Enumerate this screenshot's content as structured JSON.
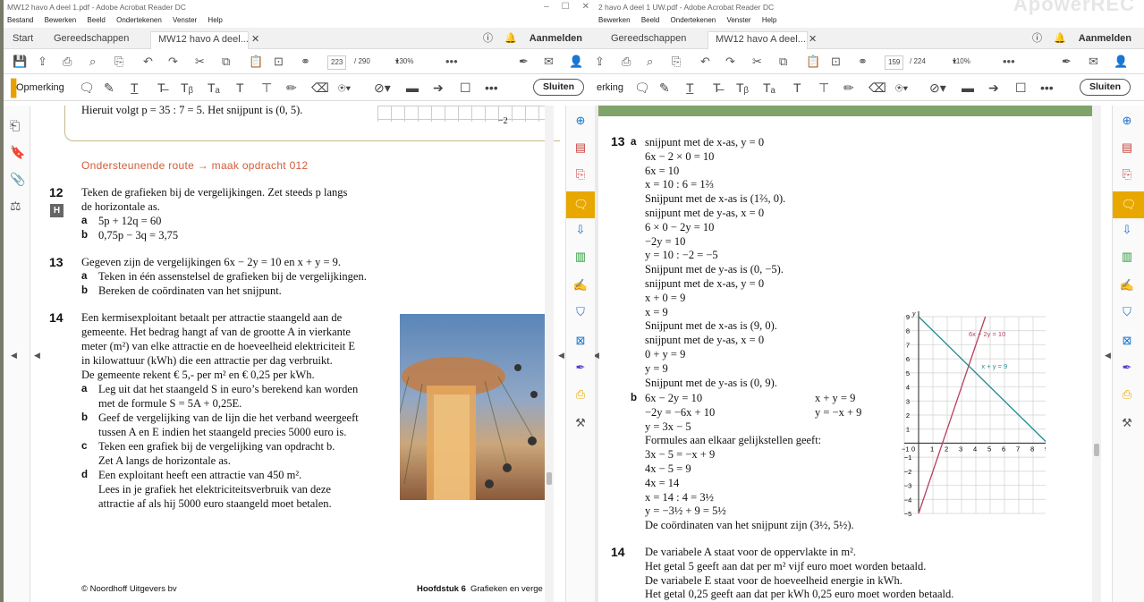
{
  "left": {
    "title": "MW12 havo A deel 1.pdf - Adobe Acrobat Reader DC",
    "menu": [
      "Bestand",
      "Bewerken",
      "Beeld",
      "Ondertekenen",
      "Venster",
      "Help"
    ],
    "tabs": {
      "start": "Start",
      "tools": "Gereedschappen",
      "doc": "MW12 havo A deel..."
    },
    "signin": "Aanmelden",
    "page_current": "223",
    "page_total": "/ 290",
    "zoom": "130%",
    "annot_label": "Opmerking",
    "close": "Sluiten",
    "content": {
      "line_top": "Hieruit volgt p = 35 : 7 = 5. Het snijpunt is (0, 5).",
      "axis_label": "−2",
      "orange": "Ondersteunende route → maak opdracht 012",
      "q12_num": "12",
      "q12_badge": "H",
      "q12_text1": "Teken de grafieken bij de vergelijkingen. Zet steeds p langs",
      "q12_text2": "de horizontale as.",
      "q12a_l": "a",
      "q12a": "5p + 12q = 60",
      "q12b_l": "b",
      "q12b": "0,75p − 3q = 3,75",
      "q13_num": "13",
      "q13_text": "Gegeven zijn de vergelijkingen 6x − 2y = 10 en x + y = 9.",
      "q13a_l": "a",
      "q13a": "Teken in één assenstelsel de grafieken bij de vergelijkingen.",
      "q13b_l": "b",
      "q13b": "Bereken de coördinaten van het snijpunt.",
      "q14_num": "14",
      "q14_lines": [
        "Een kermisexploitant betaalt per attractie staangeld aan de",
        "gemeente. Het bedrag hangt af van de grootte A in vierkante",
        "meter (m²) van elke attractie en de hoeveelheid elektriciteit E",
        "in kilowattuur (kWh) die een attractie per dag verbruikt.",
        "De gemeente rekent € 5,- per m² en € 0,25 per kWh."
      ],
      "q14a_l": "a",
      "q14a": [
        "Leg uit dat het staangeld S in euro’s berekend kan worden",
        "met de formule S = 5A + 0,25E."
      ],
      "q14b_l": "b",
      "q14b": [
        "Geef de vergelijking van de lijn die het verband weergeeft",
        "tussen A en E indien het staangeld precies 5000 euro is."
      ],
      "q14c_l": "c",
      "q14c": [
        "Teken een grafiek bij de vergelijking van opdracht b.",
        "Zet A langs de horizontale as."
      ],
      "q14d_l": "d",
      "q14d": [
        "Een exploitant heeft een attractie van 450 m².",
        "Lees in je grafiek het elektriciteitsverbruik van deze",
        "attractie af als hij 5000 euro staangeld moet betalen."
      ],
      "footer_left": "© Noordhoff Uitgevers bv",
      "footer_chapter": "Hoofdstuk 6",
      "footer_right": "Grafieken en verge"
    }
  },
  "right": {
    "title": "2 havo A deel 1 UW.pdf - Adobe Acrobat Reader DC",
    "watermark": "ApowerREC",
    "menu": [
      "Bewerken",
      "Beeld",
      "Ondertekenen",
      "Venster",
      "Help"
    ],
    "tabs": {
      "tools": "Gereedschappen",
      "doc": "MW12 havo A deel..."
    },
    "signin": "Aanmelden",
    "page_current": "159",
    "page_total": "/ 224",
    "zoom": "110%",
    "annot_label": "erking",
    "close": "Sluiten",
    "content": {
      "num13": "13",
      "a": "a",
      "b": "b",
      "sol_a": [
        "snijpunt met de x-as, y = 0",
        "6x − 2 × 0 = 10",
        "6x = 10",
        "x = 10 : 6 = 1⅔",
        "Snijpunt met de x-as is (1⅔, 0).",
        "snijpunt met de y-as, x = 0",
        "6 × 0 − 2y = 10",
        "−2y = 10",
        "y = 10 : −2 = −5",
        "Snijpunt met de y-as is (0, −5).",
        "snijpunt met de x-as, y = 0",
        "x + 0 = 9",
        "x = 9",
        "Snijpunt met de x-as is (9, 0).",
        "snijpunt met de y-as, x = 0",
        "0 + y = 9",
        "y = 9",
        "Snijpunt met de y-as is (0, 9)."
      ],
      "sol_b_left": [
        "6x − 2y = 10",
        "−2y = −6x + 10",
        "y = 3x − 5",
        "Formules aan elkaar gelijkstellen geeft:",
        "3x − 5 = −x + 9",
        "4x − 5 = 9",
        "4x = 14",
        "x = 14 : 4 = 3½",
        "y = −3½ + 9 = 5½",
        "De coördinaten van het snijpunt zijn (3½, 5½)."
      ],
      "sol_b_right": [
        "x + y = 9",
        "y = −x + 9"
      ],
      "num14": "14",
      "sol14": [
        "De variabele A staat voor de oppervlakte in m².",
        "Het getal 5 geeft aan dat per m² vijf euro moet worden betaald.",
        "De variabele E staat voor de hoeveelheid energie in kWh.",
        "Het getal 0,25 geeft aan dat per kWh 0,25 euro moet worden betaald."
      ]
    }
  },
  "chart_data": {
    "type": "line",
    "xlabel": "x",
    "ylabel": "y",
    "xlim": [
      -1,
      9
    ],
    "ylim": [
      -5,
      9
    ],
    "xticks": [
      "−1",
      "0",
      "1",
      "2",
      "3",
      "4",
      "5",
      "6",
      "7",
      "8",
      "9"
    ],
    "yticks": [
      "−5",
      "−4",
      "−3",
      "−2",
      "−1",
      "1",
      "2",
      "3",
      "4",
      "5",
      "6",
      "7",
      "8",
      "9"
    ],
    "grid": true,
    "series": [
      {
        "name": "6x − 2y = 10",
        "color": "#b8405a",
        "x": [
          0,
          4.667
        ],
        "y": [
          -5,
          9
        ]
      },
      {
        "name": "x + y = 9",
        "color": "#1e8c8c",
        "x": [
          0,
          9
        ],
        "y": [
          9,
          0
        ]
      }
    ]
  }
}
